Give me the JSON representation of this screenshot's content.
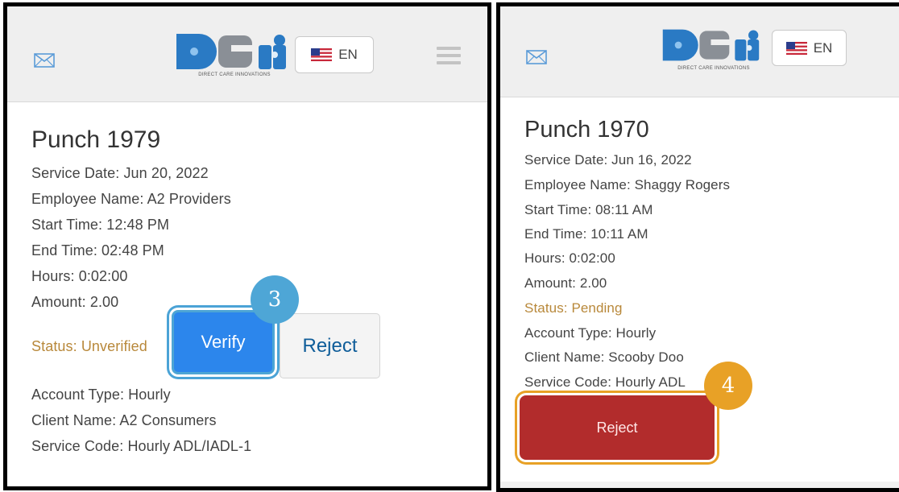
{
  "brand": {
    "tagline": "DIRECT CARE INNOVATIONS",
    "colors": {
      "logo_blue": "#2a7ac4",
      "logo_gray": "#8a8f96"
    }
  },
  "header": {
    "mail_icon": "envelope-icon",
    "language_label": "EN",
    "flag_icon": "us-flag-icon",
    "menu_icon": "hamburger-menu-icon"
  },
  "left_panel": {
    "title": "Punch 1979",
    "service_date": "Service Date: Jun 20, 2022",
    "employee_name": "Employee Name: A2 Providers",
    "start_time": "Start Time: 12:48 PM",
    "end_time": "End Time: 02:48 PM",
    "hours": "Hours: 0:02:00",
    "amount": "Amount: 2.00",
    "status": "Status: Unverified",
    "verify_label": "Verify",
    "reject_label": "Reject",
    "account_type": "Account Type: Hourly",
    "client_name": "Client Name: A2 Consumers",
    "service_code": "Service Code: Hourly ADL/IADL-1",
    "step_number": "3",
    "step_color": "#4ea6d6"
  },
  "right_panel": {
    "title": "Punch 1970",
    "service_date": "Service Date: Jun 16, 2022",
    "employee_name": "Employee Name: Shaggy Rogers",
    "start_time": "Start Time: 08:11 AM",
    "end_time": "End Time: 10:11 AM",
    "hours": "Hours: 0:02:00",
    "amount": "Amount: 2.00",
    "status": "Status: Pending",
    "account_type": "Account Type: Hourly",
    "client_name": "Client Name: Scooby Doo",
    "service_code": "Service Code: Hourly ADL",
    "reject_label": "Reject",
    "step_number": "4",
    "step_color": "#e8a126"
  },
  "colors": {
    "status_text": "#b8883a",
    "verify_button": "#2c86ec",
    "reject_button_red": "#b22c2c",
    "reject_text_blue": "#0f5d99"
  }
}
